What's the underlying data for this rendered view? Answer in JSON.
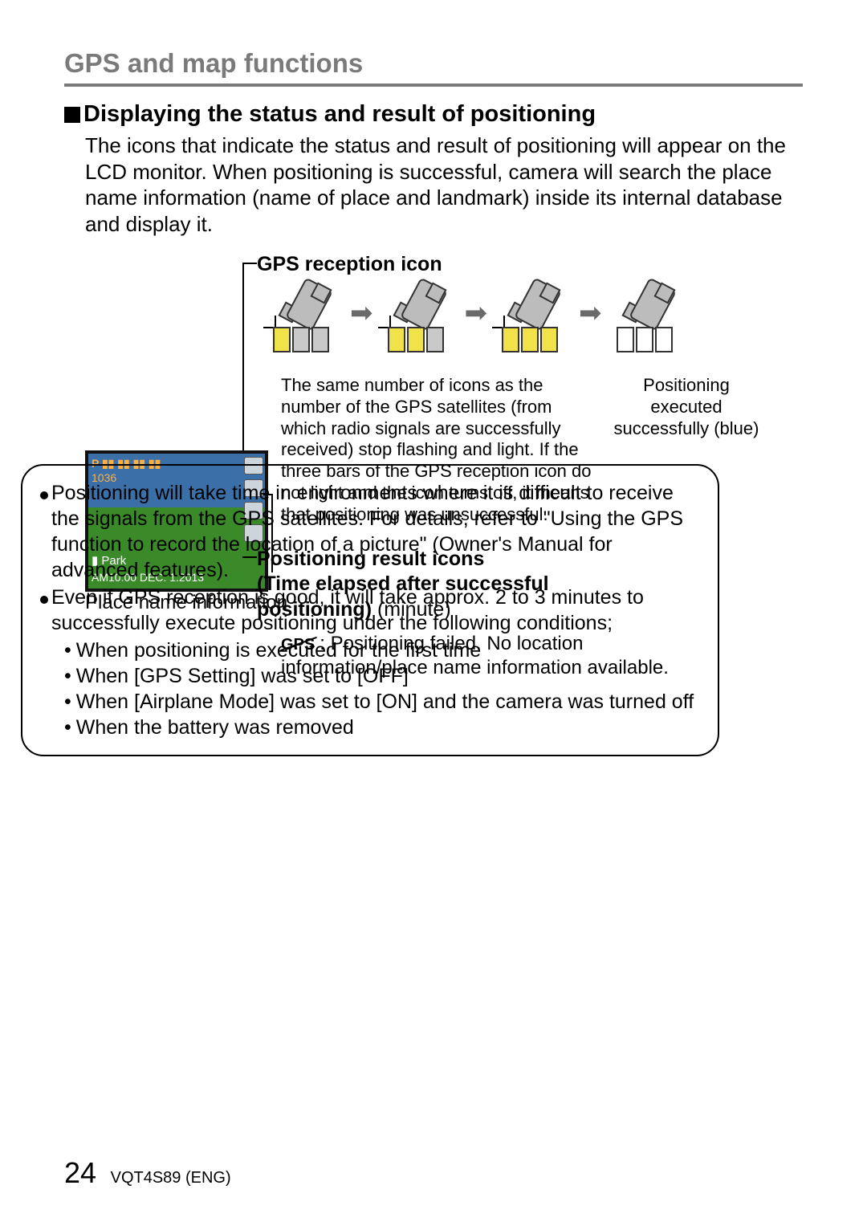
{
  "header": "GPS and map functions",
  "subheader": "Displaying the status and result of positioning",
  "intro": "The icons that indicate the status and result of positioning will appear on the LCD monitor. When positioning is successful, camera will search the place name information (name of place and landmark) inside its internal database and display it.",
  "gps_icon_label": "GPS reception icon",
  "satellite_desc": "The same number of icons as the number of the GPS satellites (from which radio signals are successfully received) stop flashing and light. If the three bars of the GPS reception icon do not light and the icon turns off, it means that positioning was unsuccessful.",
  "success_desc": "Positioning executed successfully (blue)",
  "lcd": {
    "topline": "P ▮▮ ▮▮ ▮▮ ▮▮",
    "count": "1036",
    "park": "▮ Park",
    "datetime": "AM10:00 DEC. 1.2013"
  },
  "place_name_label": "Place name information",
  "pos_result": {
    "l1": "Positioning result icons",
    "l2": "(Time elapsed after successful",
    "l3_bold": "positioning)",
    "l3_rest": " (minute)"
  },
  "gps_fail_icon": "GPS",
  "gps_fail_text": ": Positioning failed. No location information/place name information available.",
  "notes": {
    "n1": "Positioning will take time in environments where it is difficult to receive the signals from the GPS satellites. For details, refer to \"Using the GPS function to record the location of a picture\" (Owner's Manual for advanced features).",
    "n2": "Even if GPS reception is good, it will take approx. 2 to 3 minutes to successfully execute positioning under the following conditions;",
    "s1": "When positioning is executed for the first time",
    "s2": "When [GPS Setting] was set to [OFF]",
    "s3": "When [Airplane Mode] was set to [ON] and the camera was turned off",
    "s4": "When the battery was removed"
  },
  "page_number": "24",
  "doc_code": "VQT4S89 (ENG)"
}
